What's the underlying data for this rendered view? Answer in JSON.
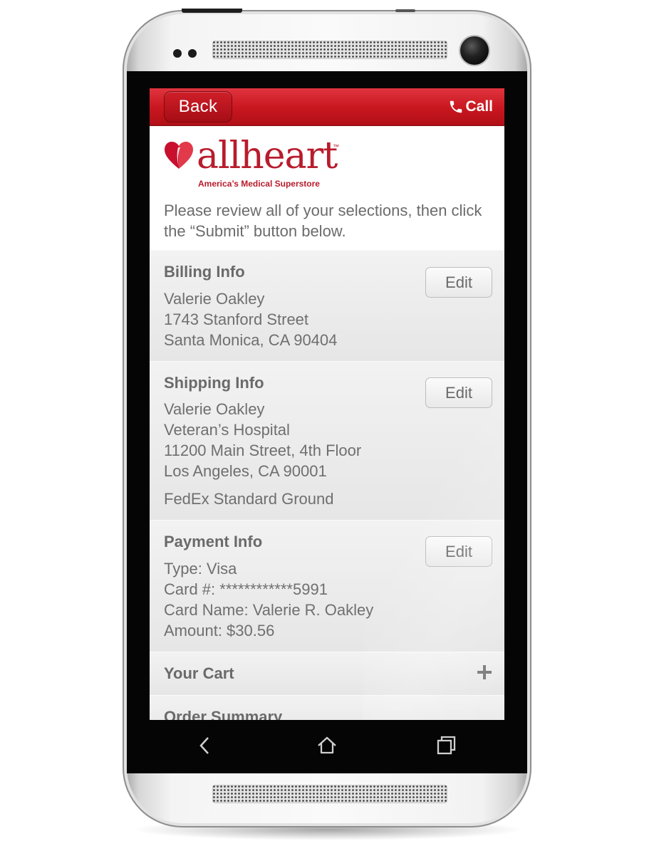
{
  "topbar": {
    "back_label": "Back",
    "call_label": "Call",
    "accent_color": "#c8161f"
  },
  "brand": {
    "name": "allheart",
    "tagline": "America’s Medical Superstore",
    "trademark": "™",
    "color": "#b81c2c"
  },
  "intro": "Please review all of your selections, then click the “Submit” button below.",
  "billing": {
    "title": "Billing Info",
    "edit_label": "Edit",
    "lines": [
      "Valerie Oakley",
      "1743 Stanford Street",
      "Santa Monica, CA 90404"
    ]
  },
  "shipping": {
    "title": "Shipping Info",
    "edit_label": "Edit",
    "lines": [
      "Valerie Oakley",
      "Veteran’s Hospital",
      "11200 Main Street, 4th Floor",
      "Los Angeles, CA 90001"
    ],
    "method": "FedEx Standard Ground"
  },
  "payment": {
    "title": "Payment Info",
    "edit_label": "Edit",
    "lines": [
      "Type: Visa",
      "Card #: ************5991",
      "Card Name: Valerie R. Oakley",
      "Amount: $30.56"
    ]
  },
  "cart": {
    "title": "Your Cart",
    "expand_icon": "plus-icon"
  },
  "order_summary": {
    "title": "Order Summary"
  },
  "navbar": {
    "icons": [
      "back-arrow-icon",
      "home-icon",
      "recent-apps-icon"
    ]
  }
}
